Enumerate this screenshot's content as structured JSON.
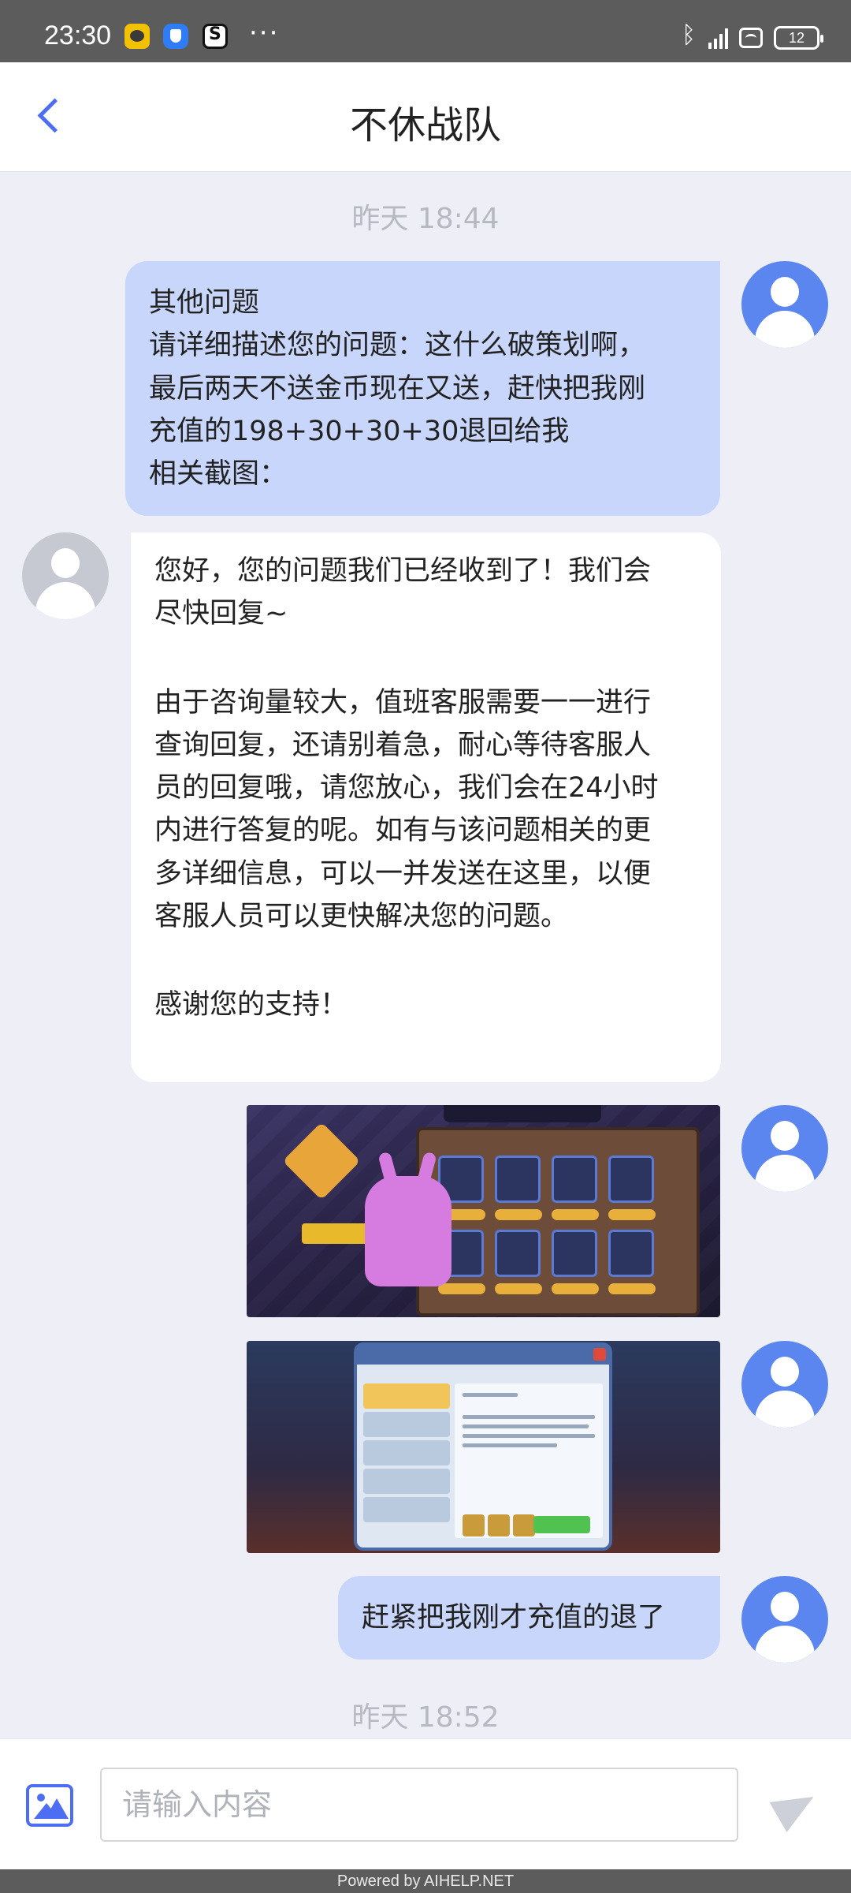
{
  "status_bar": {
    "time": "23:30",
    "battery": "12",
    "overflow": "···"
  },
  "header": {
    "title": "不休战队"
  },
  "messages": {
    "ts1": "昨天 18:44",
    "m1": [
      "其他问题",
      "请详细描述您的问题：这什么破策划啊，",
      "最后两天不送金币现在又送，赶快把我刚",
      "充值的198+30+30+30退回给我",
      "相关截图："
    ],
    "m2": [
      "您好，您的问题我们已经收到了！我们会",
      "尽快回复~",
      "",
      "由于咨询量较大，值班客服需要一一进行",
      "查询回复，还请别着急，耐心等待客服人",
      "员的回复哦，请您放心，我们会在24小时",
      "内进行答复的呢。如有与该问题相关的更",
      "多详细信息，可以一并发送在这里，以便",
      "客服人员可以更快解决您的问题。",
      "",
      "感谢您的支持！"
    ],
    "m5": "赶紧把我刚才充值的退了",
    "ts2": "昨天 18:52"
  },
  "composer": {
    "placeholder": "请输入内容"
  },
  "footer": {
    "powered_by": "Powered by AIHELP.NET"
  },
  "icons": {
    "back": "chevron-left-icon",
    "photo": "image-icon",
    "send": "send-icon",
    "avatar": "user-avatar-icon"
  },
  "colors": {
    "accent": "#4d6ef2",
    "my_bubble": "#c8d6fb",
    "their_bubble": "#ffffff",
    "background": "#eeeff6",
    "status_bar": "#5c5c5c"
  }
}
